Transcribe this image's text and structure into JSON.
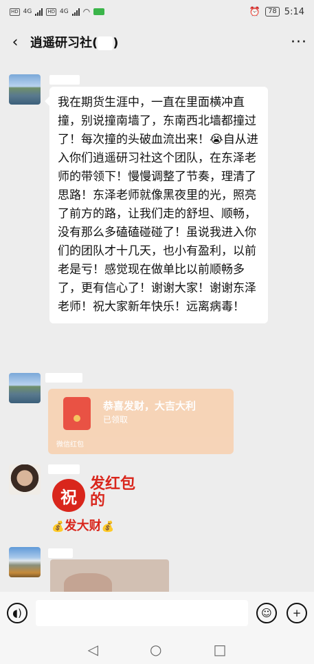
{
  "status_bar": {
    "left_indicators": [
      "HD",
      "4G",
      "HD",
      "4G"
    ],
    "battery": "78",
    "time": "5:14"
  },
  "header": {
    "title": "逍遥研习社(",
    "title_suffix": ")"
  },
  "messages": [
    {
      "type": "text",
      "text": "我在期货生涯中，一直在里面横冲直撞，别说撞南墙了，东南西北墙都撞过了！每次撞的头破血流出来！😭自从进入你们逍遥研习社这个团队，在东泽老师的带领下！慢慢调整了节奏，理清了思路！东泽老师就像黑夜里的光，照亮了前方的路，让我们走的舒坦、顺畅，没有那么多磕磕碰碰了！虽说我进入你们的团队才十几天，也小有盈利，以前老是亏！感觉现在做单比以前顺畅多了，更有信心了！谢谢大家！谢谢东泽老师！祝大家新年快乐！远离病毒！"
    },
    {
      "type": "red_packet",
      "title": "恭喜发财，大吉大利",
      "status": "已领取",
      "footer": "微信红包"
    },
    {
      "type": "sticker",
      "badge": "祝",
      "text": "发红包的",
      "sub": "发大财"
    },
    {
      "type": "image"
    }
  ],
  "icons": {
    "back": "chevron-left-icon",
    "more": "more-icon",
    "voice": "voice-icon",
    "emoji": "emoji-icon",
    "plus": "plus-icon"
  },
  "nav": {
    "back": "◁",
    "home": "○",
    "recent": "□"
  }
}
